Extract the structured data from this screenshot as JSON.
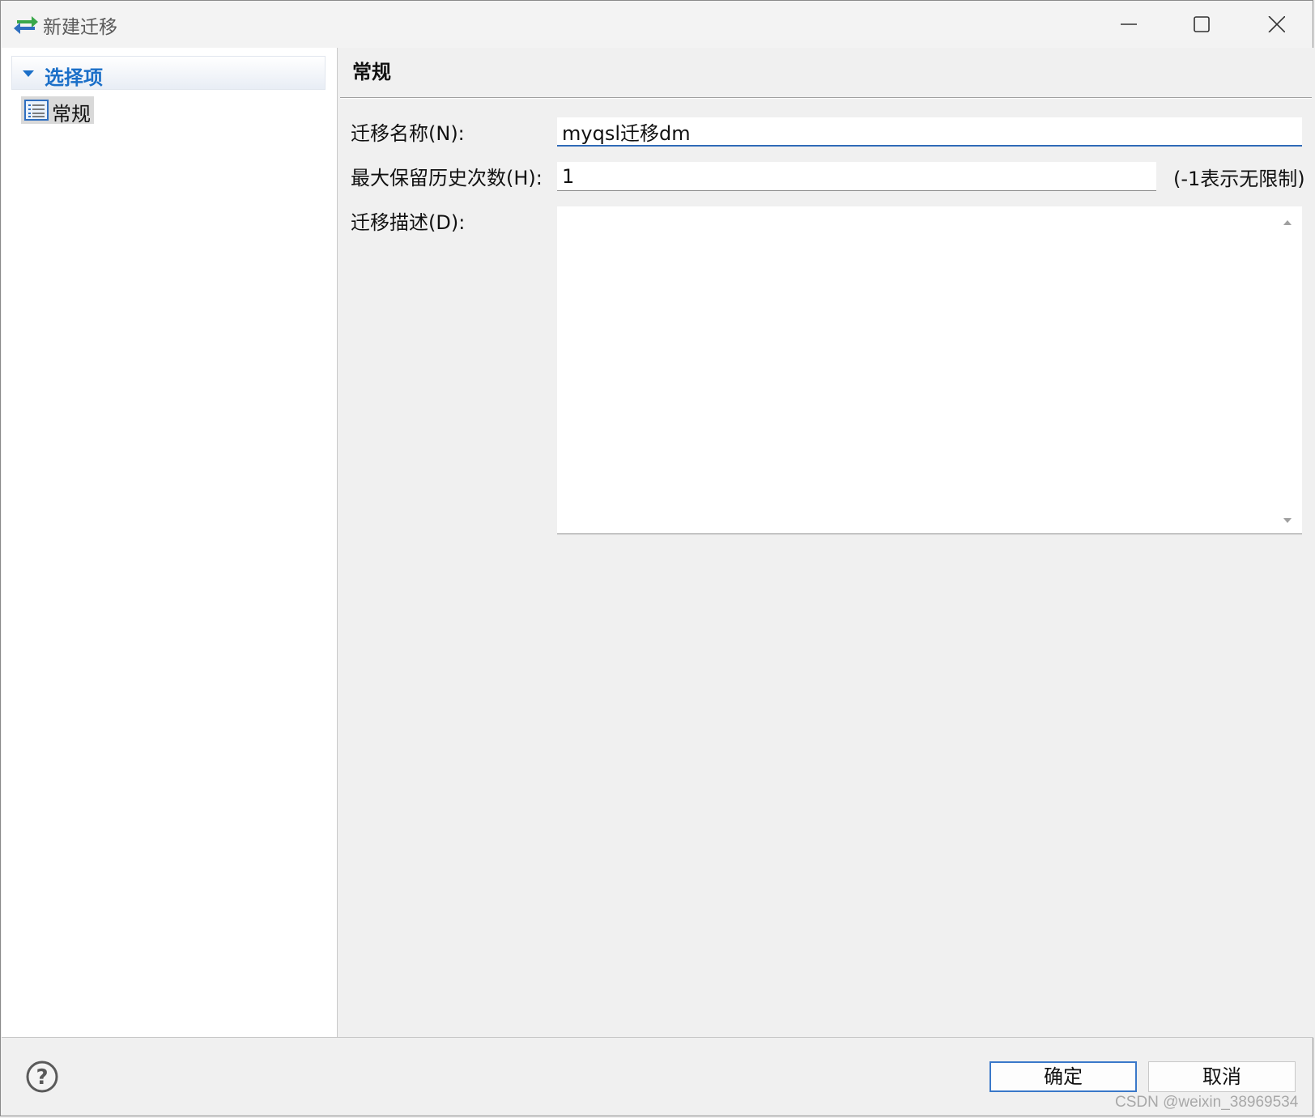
{
  "window": {
    "title": "新建迁移",
    "icon": "migrate-arrows-icon"
  },
  "sidebar": {
    "header": "选择项",
    "items": [
      {
        "label": "常规",
        "icon": "list-page-icon",
        "selected": true
      }
    ]
  },
  "main": {
    "section_title": "常规",
    "fields": {
      "name_label": "迁移名称(N):",
      "name_value": "myqsl迁移dm",
      "history_label": "最大保留历史次数(H):",
      "history_value": "1",
      "history_hint": "(-1表示无限制)",
      "desc_label": "迁移描述(D):",
      "desc_value": ""
    }
  },
  "footer": {
    "help_icon": "help-icon",
    "ok_label": "确定",
    "cancel_label": "取消"
  },
  "watermark": "CSDN @weixin_38969534",
  "colors": {
    "accent": "#1b6fc8",
    "focus_border": "#2f6bb8",
    "ok_border": "#3a78c9",
    "window_bg": "#f0f0f0"
  }
}
